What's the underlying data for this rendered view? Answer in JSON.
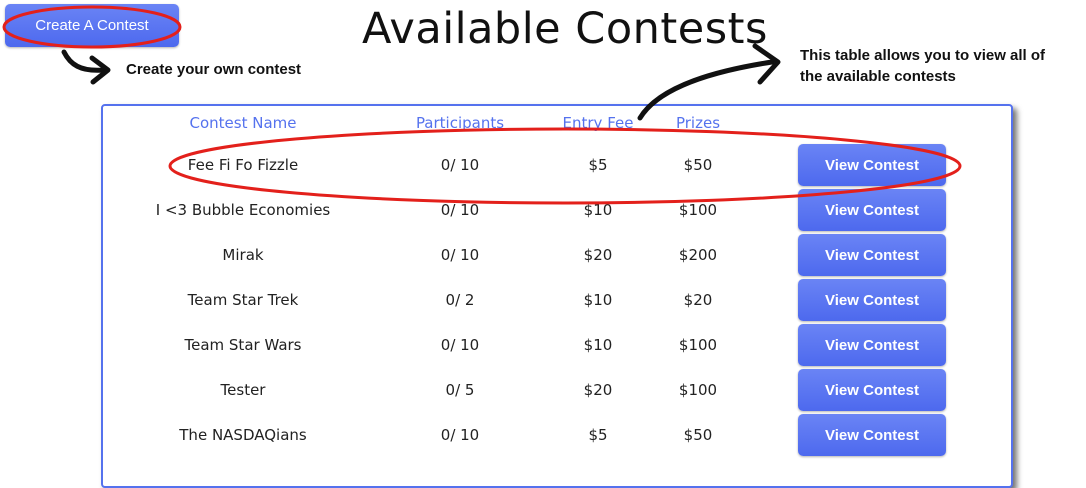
{
  "create_button": {
    "label": "Create A Contest"
  },
  "title": "Available Contests",
  "notes": {
    "create": "Create your own contest",
    "table_line1": "This table allows you to view all of",
    "table_line2": "the available contests"
  },
  "table": {
    "headers": [
      "Contest Name",
      "Participants",
      "Entry Fee",
      "Prizes"
    ],
    "button_label": "View Contest",
    "rows": [
      {
        "name": "Fee Fi Fo Fizzle",
        "participants": "0/ 10",
        "fee": "$5",
        "prizes": "$50"
      },
      {
        "name": "I <3 Bubble Economies",
        "participants": "0/ 10",
        "fee": "$10",
        "prizes": "$100"
      },
      {
        "name": "Mirak",
        "participants": "0/ 10",
        "fee": "$20",
        "prizes": "$200"
      },
      {
        "name": "Team Star Trek",
        "participants": "0/ 2",
        "fee": "$10",
        "prizes": "$20"
      },
      {
        "name": "Team Star Wars",
        "participants": "0/ 10",
        "fee": "$10",
        "prizes": "$100"
      },
      {
        "name": "Tester",
        "participants": "0/ 5",
        "fee": "$20",
        "prizes": "$100"
      },
      {
        "name": "The NASDAQians",
        "participants": "0/ 10",
        "fee": "$5",
        "prizes": "$50"
      }
    ]
  }
}
